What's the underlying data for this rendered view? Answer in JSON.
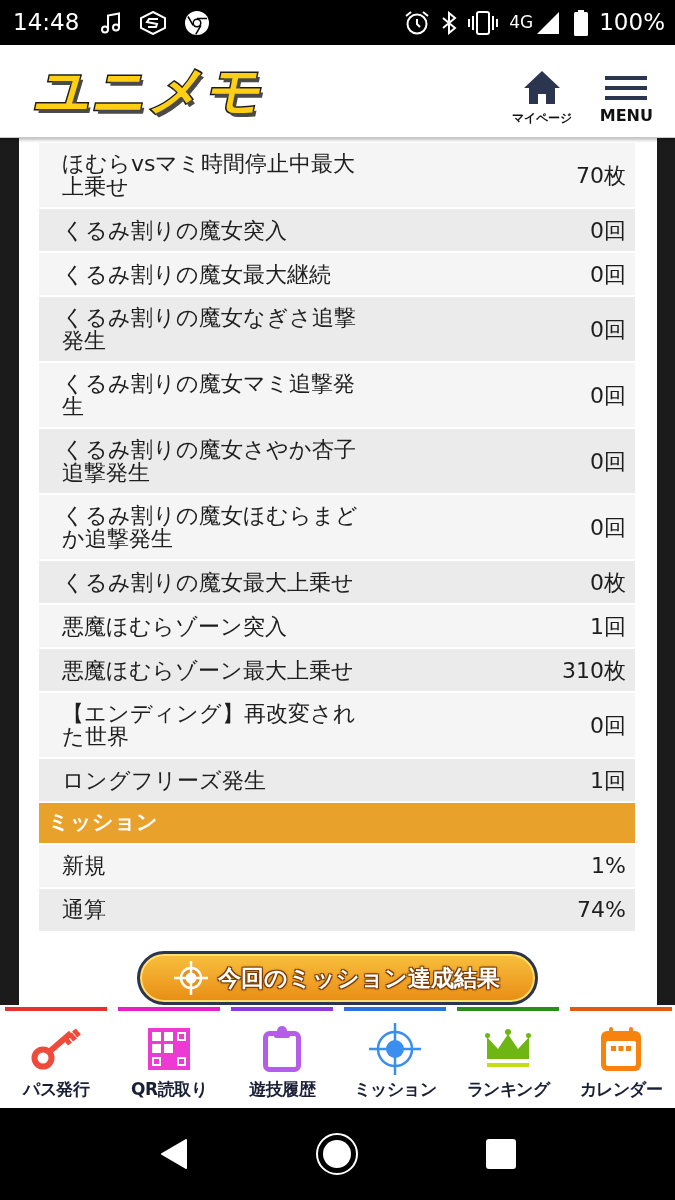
{
  "status_bar": {
    "time": "14:48",
    "network": "4G",
    "battery": "100%"
  },
  "header": {
    "logo": "ユニメモ",
    "nav": [
      {
        "kind": "home",
        "label": "マイページ"
      },
      {
        "kind": "menu",
        "label": "MENU"
      }
    ]
  },
  "stats": [
    {
      "label": "ほむらvsマミ時間停止中最大上乗せ",
      "value": "70枚"
    },
    {
      "label": "くるみ割りの魔女突入",
      "value": "0回"
    },
    {
      "label": "くるみ割りの魔女最大継続",
      "value": "0回"
    },
    {
      "label": "くるみ割りの魔女なぎさ追撃発生",
      "value": "0回"
    },
    {
      "label": "くるみ割りの魔女マミ追撃発生",
      "value": "0回"
    },
    {
      "label": "くるみ割りの魔女さやか杏子追撃発生",
      "value": "0回"
    },
    {
      "label": "くるみ割りの魔女ほむらまどか追撃発生",
      "value": "0回"
    },
    {
      "label": "くるみ割りの魔女最大上乗せ",
      "value": "0枚"
    },
    {
      "label": "悪魔ほむらゾーン突入",
      "value": "1回"
    },
    {
      "label": "悪魔ほむらゾーン最大上乗せ",
      "value": "310枚"
    },
    {
      "label": "【エンディング】再改変された世界",
      "value": "0回"
    },
    {
      "label": "ロングフリーズ発生",
      "value": "1回"
    }
  ],
  "mission": {
    "title": "ミッション",
    "rows": [
      {
        "label": "新規",
        "value": "1%"
      },
      {
        "label": "通算",
        "value": "74%"
      }
    ]
  },
  "result_button": {
    "label": "今回のミッション達成結果"
  },
  "bottom_nav": [
    {
      "kind": "key",
      "label": "パス発行",
      "color": "#e8312f"
    },
    {
      "kind": "qr",
      "label": "QR読取り",
      "color": "#e91ec8"
    },
    {
      "kind": "clipboard",
      "label": "遊技履歴",
      "color": "#8e3ae0"
    },
    {
      "kind": "target",
      "label": "ミッション",
      "color": "#2e6fe0"
    },
    {
      "kind": "crown",
      "label": "ランキング",
      "color": "#2e8b1e"
    },
    {
      "kind": "calendar",
      "label": "カレンダー",
      "color": "#e05a10"
    }
  ]
}
